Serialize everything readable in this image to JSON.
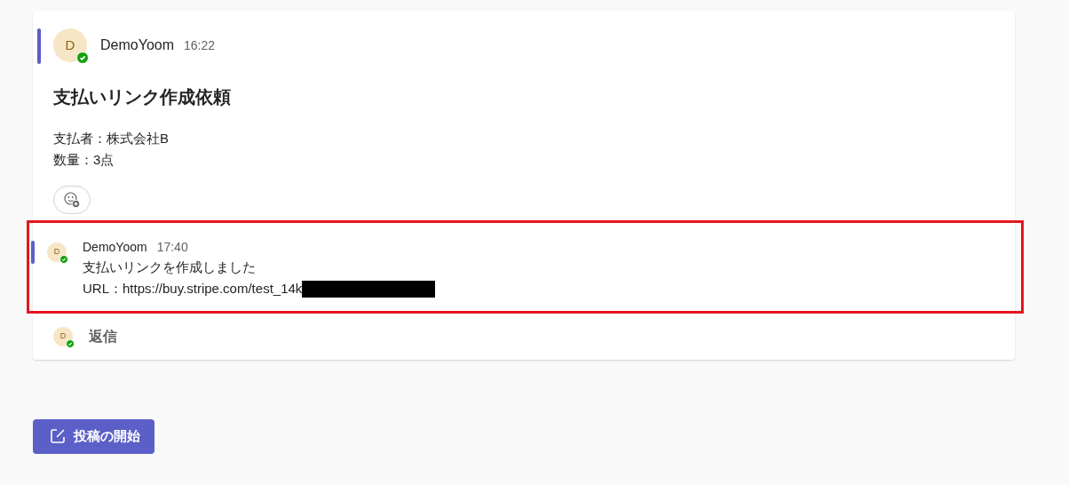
{
  "post": {
    "author": {
      "initial": "D",
      "name": "DemoYoom",
      "online": true
    },
    "time": "16:22",
    "subject": "支払いリンク作成依頼",
    "lines": [
      "支払者：株式会社B",
      "数量：3点"
    ]
  },
  "replies": [
    {
      "author": {
        "initial": "D",
        "name": "DemoYoom",
        "online": true
      },
      "time": "17:40",
      "lines": [
        "支払いリンクを作成しました",
        "URL：https://buy.stripe.com/test_14k"
      ],
      "redacted": true,
      "highlighted": true
    }
  ],
  "reply_bar": {
    "initial": "D",
    "online": true,
    "label": "返信"
  },
  "new_post_button": "投稿の開始"
}
